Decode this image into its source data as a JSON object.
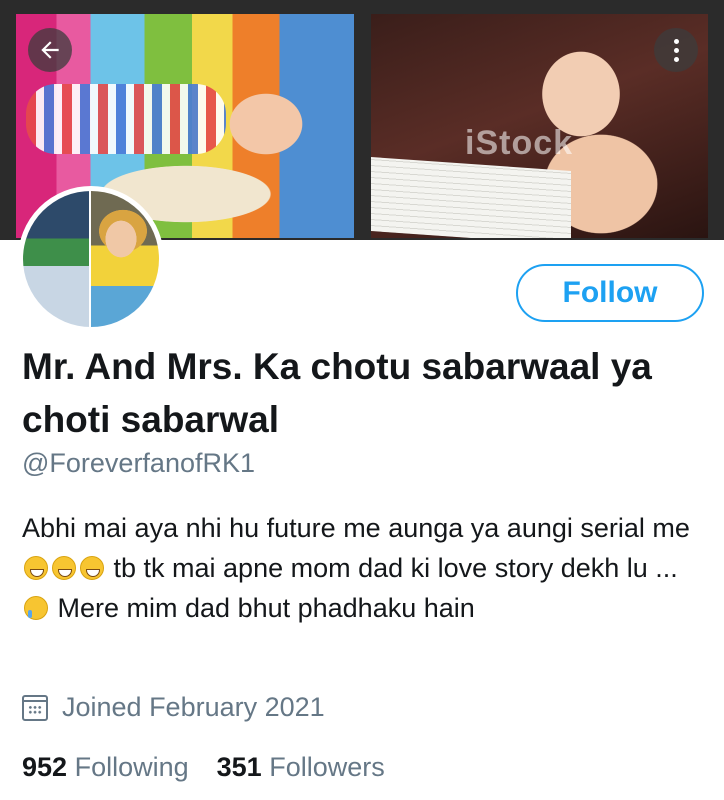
{
  "banner": {
    "watermark": "iStock"
  },
  "profile": {
    "name": "Mr. And Mrs. Ka chotu sabarwaal ya choti sabarwal",
    "handle": "@ForeverfanofRK1",
    "bio": {
      "part1": "Abhi mai aya nhi hu future me aunga ya aungi serial me",
      "part2": "tb tk mai apne mom dad ki love story dekh lu ...",
      "part3": "Mere  mim dad bhut phadhaku hain"
    },
    "joined": "Joined February 2021",
    "following_count": "952",
    "following_label": "Following",
    "followers_count": "351",
    "followers_label": "Followers"
  },
  "actions": {
    "follow_label": "Follow",
    "back_icon": "arrow-left-icon",
    "more_icon": "more-vertical-icon"
  },
  "colors": {
    "accent": "#1da1f2",
    "secondary_text": "#657786",
    "primary_text": "#14171a"
  }
}
